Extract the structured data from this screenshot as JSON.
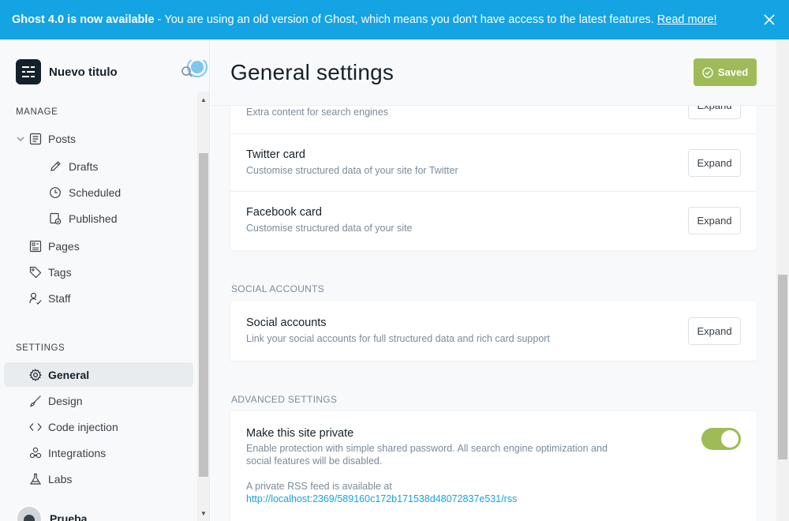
{
  "banner": {
    "version_text": "Ghost 4.0 is now available",
    "separator": "-",
    "message": "You are using an old version of Ghost, which means you don't have access to the latest features.",
    "link": "Read more!",
    "close_icon": "close-icon"
  },
  "sidebar": {
    "site_title": "Nuevo titulo",
    "manage_label": "MANAGE",
    "settings_label": "SETTINGS",
    "manage_items": [
      {
        "label": "Posts",
        "icon": "posts-icon"
      },
      {
        "label": "Drafts",
        "icon": "pencil-icon"
      },
      {
        "label": "Scheduled",
        "icon": "clock-icon"
      },
      {
        "label": "Published",
        "icon": "published-icon"
      },
      {
        "label": "Pages",
        "icon": "pages-icon"
      },
      {
        "label": "Tags",
        "icon": "tag-icon"
      },
      {
        "label": "Staff",
        "icon": "staff-icon"
      }
    ],
    "settings_items": [
      {
        "label": "General",
        "icon": "gear-icon",
        "active": true
      },
      {
        "label": "Design",
        "icon": "brush-icon"
      },
      {
        "label": "Code injection",
        "icon": "code-icon"
      },
      {
        "label": "Integrations",
        "icon": "integrations-icon"
      },
      {
        "label": "Labs",
        "icon": "flask-icon"
      }
    ],
    "user_name": "Prueba"
  },
  "main": {
    "title": "General settings",
    "saved_label": "Saved",
    "meta_card": {
      "rows": [
        {
          "title": "",
          "desc": "Extra content for search engines",
          "button": "Expand"
        },
        {
          "title": "Twitter card",
          "desc": "Customise structured data of your site for Twitter",
          "button": "Expand"
        },
        {
          "title": "Facebook card",
          "desc": "Customise structured data of your site",
          "button": "Expand"
        }
      ]
    },
    "social_section": {
      "heading": "SOCIAL ACCOUNTS",
      "title": "Social accounts",
      "desc": "Link your social accounts for full structured data and rich card support",
      "button": "Expand"
    },
    "advanced_section": {
      "heading": "ADVANCED SETTINGS",
      "title": "Make this site private",
      "desc_line1": "Enable protection with simple shared password. All search engine optimization and",
      "desc_line2": "social features will be disabled.",
      "rss_text": "A private RSS feed is available at",
      "rss_url": "http://localhost:2369/589160c172b171538d48072837e531/rss",
      "toggle_on": true
    }
  },
  "colors": {
    "banner": "#14a3e3",
    "accent_green": "#9fbb58",
    "link": "#14a3e3"
  }
}
